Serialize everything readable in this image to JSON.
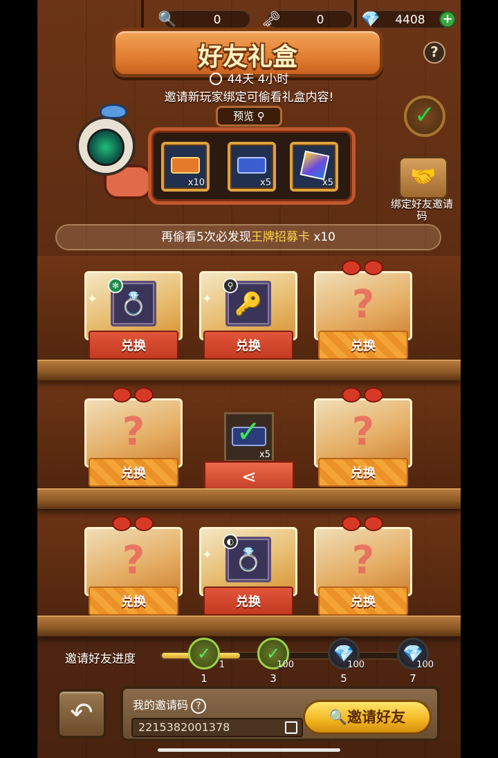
{
  "topbar": {
    "magnifier_count": "0",
    "key_count": "0",
    "diamond_count": "4408",
    "icons": [
      "magnifier-icon",
      "key-icon",
      "diamond-icon",
      "plus-icon"
    ]
  },
  "title": "好友礼盒",
  "timer": "44天  4小时",
  "subtitle": "邀请新玩家绑定可偷看礼盒内容!",
  "preview": {
    "label": "预览",
    "items": [
      {
        "qty": "x10"
      },
      {
        "qty": "x5"
      },
      {
        "qty": "x5"
      }
    ]
  },
  "bind": {
    "label": "绑定好友邀请码"
  },
  "banner": {
    "prefix": "再偷看5次必发现",
    "highlight": "王牌招募卡",
    "suffix": " x10"
  },
  "shelves": {
    "exchange_label": "兑换",
    "locked_mark": "?",
    "center_gift_qty": "x5"
  },
  "progress": {
    "label": "邀请好友进度",
    "fill_fraction": 0.3,
    "nodes": [
      {
        "count": "1",
        "reward": "1"
      },
      {
        "count": "3",
        "reward": "100"
      },
      {
        "count": "5",
        "reward": "100"
      },
      {
        "count": "7",
        "reward": "100"
      }
    ]
  },
  "footer": {
    "code_label": "我的邀请码",
    "code_value": "2215382001378",
    "invite_label": "邀请好友"
  },
  "colors": {
    "accent": "#ffd34a",
    "exchange_red": "#c23a20",
    "wood": "#5a2b12"
  }
}
